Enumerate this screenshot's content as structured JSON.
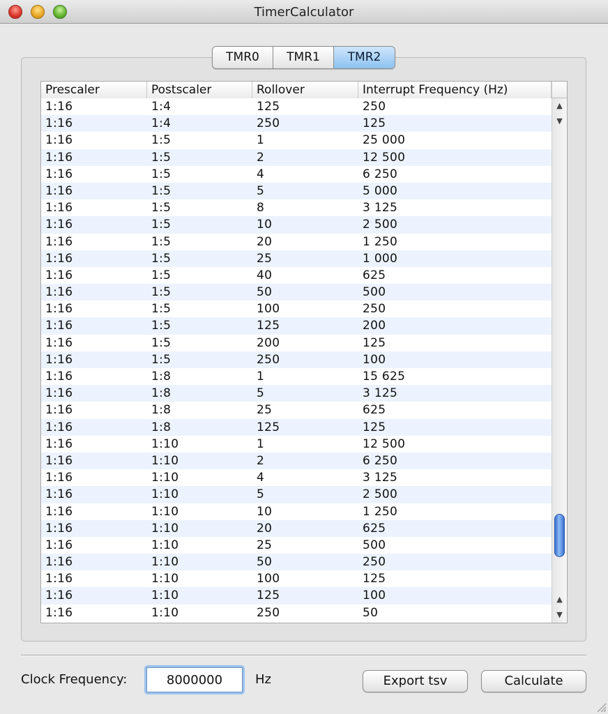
{
  "window": {
    "title": "TimerCalculator"
  },
  "tabs": [
    {
      "label": "TMR0",
      "active": false
    },
    {
      "label": "TMR1",
      "active": false
    },
    {
      "label": "TMR2",
      "active": true
    }
  ],
  "table": {
    "columns": [
      "Prescaler",
      "Postscaler",
      "Rollover",
      "Interrupt Frequency (Hz)"
    ],
    "rows": [
      [
        "1:16",
        "1:4",
        "125",
        "250"
      ],
      [
        "1:16",
        "1:4",
        "250",
        "125"
      ],
      [
        "1:16",
        "1:5",
        "1",
        "25 000"
      ],
      [
        "1:16",
        "1:5",
        "2",
        "12 500"
      ],
      [
        "1:16",
        "1:5",
        "4",
        "6 250"
      ],
      [
        "1:16",
        "1:5",
        "5",
        "5 000"
      ],
      [
        "1:16",
        "1:5",
        "8",
        "3 125"
      ],
      [
        "1:16",
        "1:5",
        "10",
        "2 500"
      ],
      [
        "1:16",
        "1:5",
        "20",
        "1 250"
      ],
      [
        "1:16",
        "1:5",
        "25",
        "1 000"
      ],
      [
        "1:16",
        "1:5",
        "40",
        "625"
      ],
      [
        "1:16",
        "1:5",
        "50",
        "500"
      ],
      [
        "1:16",
        "1:5",
        "100",
        "250"
      ],
      [
        "1:16",
        "1:5",
        "125",
        "200"
      ],
      [
        "1:16",
        "1:5",
        "200",
        "125"
      ],
      [
        "1:16",
        "1:5",
        "250",
        "100"
      ],
      [
        "1:16",
        "1:8",
        "1",
        "15 625"
      ],
      [
        "1:16",
        "1:8",
        "5",
        "3 125"
      ],
      [
        "1:16",
        "1:8",
        "25",
        "625"
      ],
      [
        "1:16",
        "1:8",
        "125",
        "125"
      ],
      [
        "1:16",
        "1:10",
        "1",
        "12 500"
      ],
      [
        "1:16",
        "1:10",
        "2",
        "6 250"
      ],
      [
        "1:16",
        "1:10",
        "4",
        "3 125"
      ],
      [
        "1:16",
        "1:10",
        "5",
        "2 500"
      ],
      [
        "1:16",
        "1:10",
        "10",
        "1 250"
      ],
      [
        "1:16",
        "1:10",
        "20",
        "625"
      ],
      [
        "1:16",
        "1:10",
        "25",
        "500"
      ],
      [
        "1:16",
        "1:10",
        "50",
        "250"
      ],
      [
        "1:16",
        "1:10",
        "100",
        "125"
      ],
      [
        "1:16",
        "1:10",
        "125",
        "100"
      ],
      [
        "1:16",
        "1:10",
        "250",
        "50"
      ]
    ],
    "scroll_position": 0.92
  },
  "footer": {
    "clock_label": "Clock Frequency:",
    "clock_value": "8000000",
    "unit_label": "Hz",
    "export_label": "Export tsv",
    "calculate_label": "Calculate"
  },
  "icons": {
    "close": "close-icon",
    "minimize": "minimize-icon",
    "zoom": "zoom-icon",
    "resize": "resize-grip-icon"
  },
  "colors": {
    "active_tab": "#8cc2f0",
    "row_stripe": "#ecf3fe",
    "scroll_thumb": "#3a6fd1",
    "focus_ring": "#9cc3ee"
  }
}
